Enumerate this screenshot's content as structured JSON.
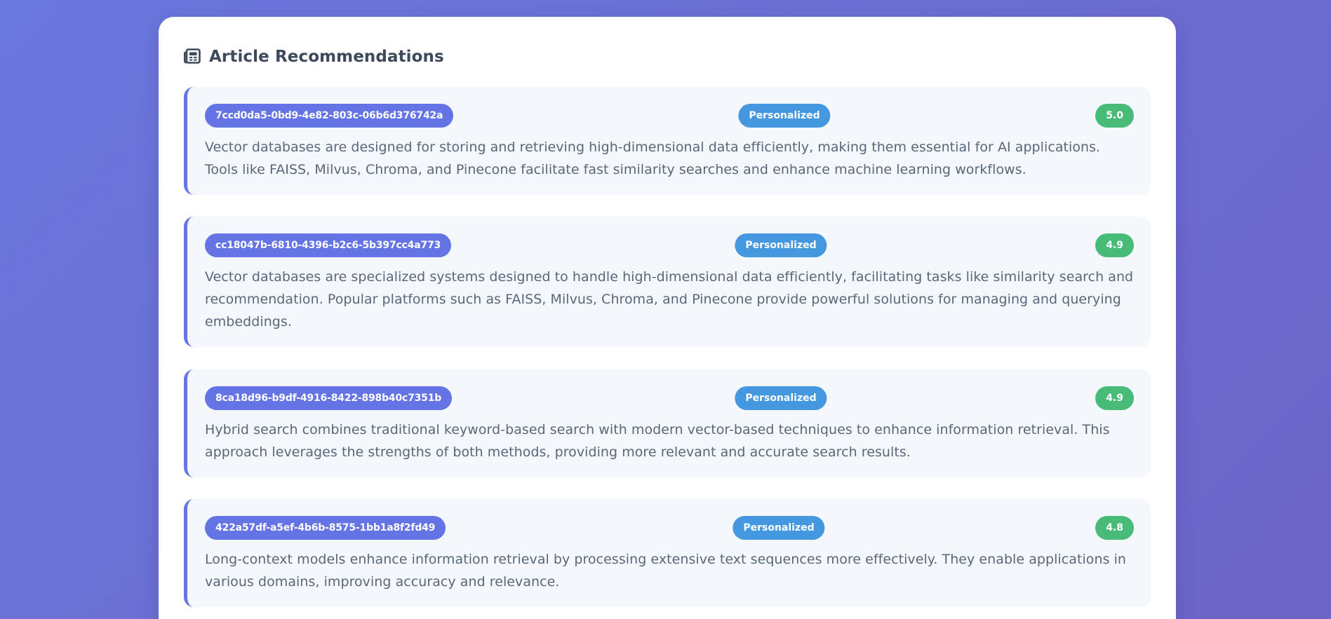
{
  "header": {
    "title": "Article Recommendations",
    "icon": "newspaper-icon"
  },
  "colors": {
    "accent": "#6577e2",
    "type_badge": "#4498e0",
    "score_badge": "#48bb78",
    "card_bg": "#f4f8fc"
  },
  "articles": [
    {
      "id": "7ccd0da5-0bd9-4e82-803c-06b6d376742a",
      "type": "Personalized",
      "score": "5.0",
      "text": "Vector databases are designed for storing and retrieving high-dimensional data efficiently, making them essential for AI applications. Tools like FAISS, Milvus, Chroma, and Pinecone facilitate fast similarity searches and enhance machine learning workflows."
    },
    {
      "id": "cc18047b-6810-4396-b2c6-5b397cc4a773",
      "type": "Personalized",
      "score": "4.9",
      "text": "Vector databases are specialized systems designed to handle high-dimensional data efficiently, facilitating tasks like similarity search and recommendation. Popular platforms such as FAISS, Milvus, Chroma, and Pinecone provide powerful solutions for managing and querying embeddings."
    },
    {
      "id": "8ca18d96-b9df-4916-8422-898b40c7351b",
      "type": "Personalized",
      "score": "4.9",
      "text": "Hybrid search combines traditional keyword-based search with modern vector-based techniques to enhance information retrieval. This approach leverages the strengths of both methods, providing more relevant and accurate search results."
    },
    {
      "id": "422a57df-a5ef-4b6b-8575-1bb1a8f2fd49",
      "type": "Personalized",
      "score": "4.8",
      "text": "Long-context models enhance information retrieval by processing extensive text sequences more effectively. They enable applications in various domains, improving accuracy and relevance."
    }
  ]
}
